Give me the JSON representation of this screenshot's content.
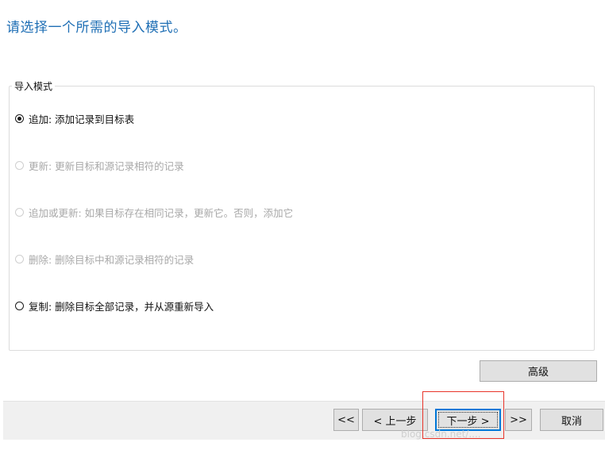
{
  "instruction": "请选择一个所需的导入模式。",
  "group": {
    "legend": "导入模式",
    "options": [
      {
        "label": "追加: 添加记录到目标表",
        "checked": true,
        "enabled": true
      },
      {
        "label": "更新: 更新目标和源记录相符的记录",
        "checked": false,
        "enabled": false
      },
      {
        "label": "追加或更新: 如果目标存在相同记录，更新它。否则，添加它",
        "checked": false,
        "enabled": false
      },
      {
        "label": "删除: 删除目标中和源记录相符的记录",
        "checked": false,
        "enabled": false
      },
      {
        "label": "复制: 删除目标全部记录，并从源重新导入",
        "checked": false,
        "enabled": true
      }
    ]
  },
  "advanced_button": "高级",
  "nav": {
    "first": "<<",
    "prev": "< 上一步",
    "next": "下一步 >",
    "last": ">>",
    "cancel": "取消"
  },
  "watermark": "blog.csdn.net/...."
}
